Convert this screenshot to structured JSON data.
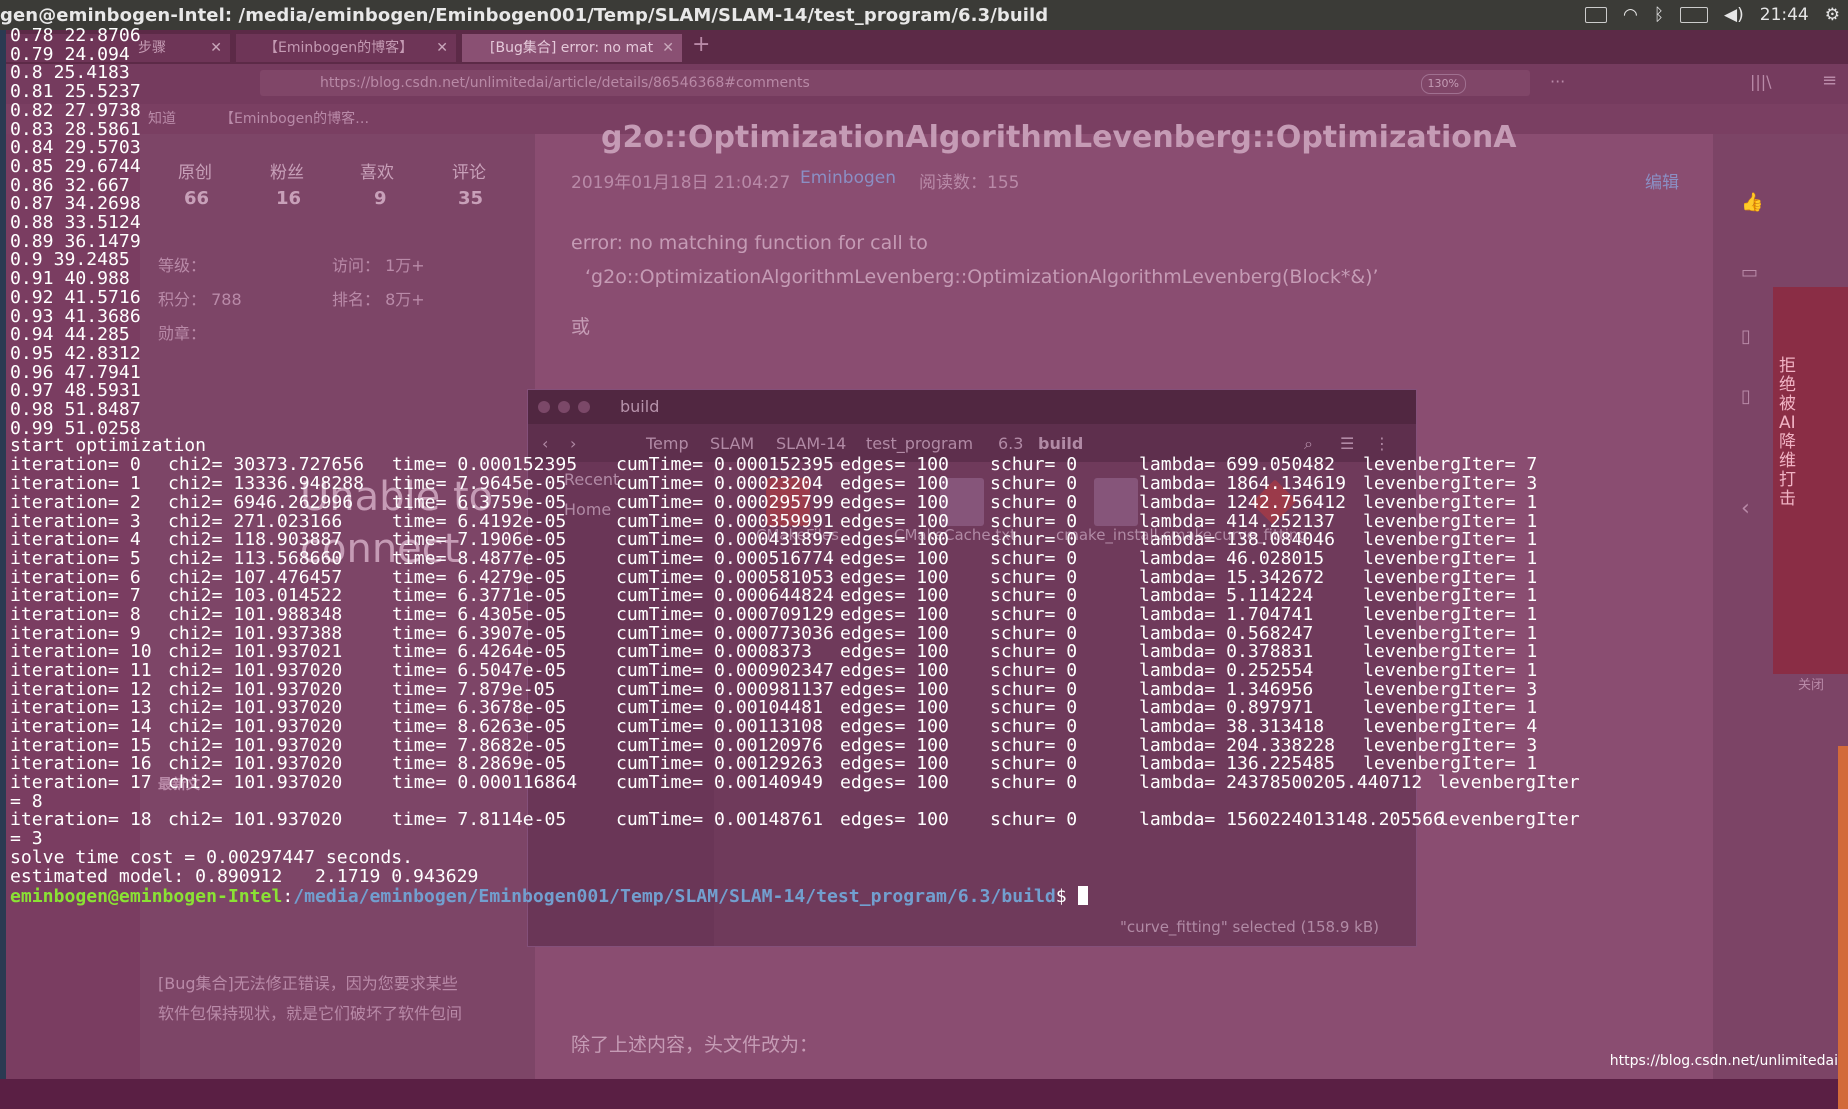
{
  "topbar": {
    "title": "gen@eminbogen-Intel: /media/eminbogen/Eminbogen001/Temp/SLAM/SLAM-14/test_program/6.3/build",
    "clock": "21:44"
  },
  "browser": {
    "tabs": [
      "步骤",
      "【Eminbogen的博客】",
      "[Bug集合] error: no mat"
    ],
    "url": "https://blog.csdn.net/unlimitedai/article/details/86546368#comments",
    "zoom": "130%",
    "bookmark_1": "知道",
    "bookmark_2": "【Eminbogen的博客…",
    "article_title": "g2o::OptimizationAlgorithmLevenberg::OptimizationA",
    "article_date": "2019年01月18日 21:04:27",
    "article_author": "Eminbogen",
    "article_reads": "阅读数：155",
    "edit_link": "编辑",
    "body_line_1": "error: no matching function for call to",
    "body_line_2": "‘g2o::OptimizationAlgorithmLevenberg::OptimizationAlgorithmLevenberg(Block*&)’",
    "body_line_3": "或",
    "body_line_4": "除了上述内容，头文件改为：",
    "stats": [
      {
        "label": "原创",
        "value": "66"
      },
      {
        "label": "粉丝",
        "value": "16"
      },
      {
        "label": "喜欢",
        "value": "9"
      },
      {
        "label": "评论",
        "value": "35"
      }
    ],
    "level_label": "等级：",
    "visits": "访问：  1万+",
    "points": "积分：  788",
    "rank": "排名：  8万+",
    "medal": "勋章：",
    "unable_1": "Unable to",
    "unable_2": "connect",
    "latest": "最新文",
    "side_link_1": "[Bug集合]无法修正错误，因为您要求某些",
    "side_link_2": "软件包保持现状，就是它们破坏了软件包间",
    "rail_close": "关闭",
    "rail_promo": "拒绝被AI降维打击"
  },
  "filemgr": {
    "title": "build",
    "crumbs": [
      "Temp",
      "SLAM",
      "SLAM-14",
      "test_program",
      "6.3",
      "build"
    ],
    "side_items": [
      "Recent",
      "Home"
    ],
    "files": [
      "CMakeFiles",
      "CMakeCache.txt",
      "cmake_install.cmake",
      "curve_fitting"
    ],
    "status": "\"curve_fitting\" selected (158.9 kB)"
  },
  "terminal": {
    "data_lines": [
      "0.78 22.8706",
      "0.79 24.094",
      "0.8 25.4183",
      "0.81 25.5237",
      "0.82 27.9738",
      "0.83 28.5861",
      "0.84 29.5703",
      "0.85 29.6744",
      "0.86 32.667",
      "0.87 34.2698",
      "0.88 33.5124",
      "0.89 36.1479",
      "0.9 39.2485",
      "0.91 40.988",
      "0.92 41.5716",
      "0.93 41.3686",
      "0.94 44.285",
      "0.95 42.8312",
      "0.96 47.7941",
      "0.97 48.5931",
      "0.98 51.8487",
      "0.99 51.0258"
    ],
    "start": "start optimization",
    "iterations": [
      {
        "it": "iteration= 0",
        "chi": "chi2= 30373.727656",
        "time": "time= 0.000152395",
        "cum": "cumTime= 0.000152395",
        "edges": "edges= 100",
        "schur": "schur= 0",
        "lambda": "lambda= 699.050482",
        "lev": "levenbergIter= 7"
      },
      {
        "it": "iteration= 1",
        "chi": "chi2= 13336.948288",
        "time": "time= 7.9645e-05",
        "cum": "cumTime= 0.00023204",
        "edges": "edges= 100",
        "schur": "schur= 0",
        "lambda": "lambda= 1864.134619",
        "lev": "levenbergIter= 3"
      },
      {
        "it": "iteration= 2",
        "chi": "chi2= 6946.262996",
        "time": "time= 6.3759e-05",
        "cum": "cumTime= 0.000295799",
        "edges": "edges= 100",
        "schur": "schur= 0",
        "lambda": "lambda= 1242.756412",
        "lev": "levenbergIter= 1"
      },
      {
        "it": "iteration= 3",
        "chi": "chi2= 271.023166",
        "time": "time= 6.4192e-05",
        "cum": "cumTime= 0.000359991",
        "edges": "edges= 100",
        "schur": "schur= 0",
        "lambda": "lambda= 414.252137",
        "lev": "levenbergIter= 1"
      },
      {
        "it": "iteration= 4",
        "chi": "chi2= 118.903887",
        "time": "time= 7.1906e-05",
        "cum": "cumTime= 0.000431897",
        "edges": "edges= 100",
        "schur": "schur= 0",
        "lambda": "lambda= 138.084046",
        "lev": "levenbergIter= 1"
      },
      {
        "it": "iteration= 5",
        "chi": "chi2= 113.568660",
        "time": "time= 8.4877e-05",
        "cum": "cumTime= 0.000516774",
        "edges": "edges= 100",
        "schur": "schur= 0",
        "lambda": "lambda= 46.028015",
        "lev": "levenbergIter= 1"
      },
      {
        "it": "iteration= 6",
        "chi": "chi2= 107.476457",
        "time": "time= 6.4279e-05",
        "cum": "cumTime= 0.000581053",
        "edges": "edges= 100",
        "schur": "schur= 0",
        "lambda": "lambda= 15.342672",
        "lev": "levenbergIter= 1"
      },
      {
        "it": "iteration= 7",
        "chi": "chi2= 103.014522",
        "time": "time= 6.3771e-05",
        "cum": "cumTime= 0.000644824",
        "edges": "edges= 100",
        "schur": "schur= 0",
        "lambda": "lambda= 5.114224",
        "lev": "levenbergIter= 1"
      },
      {
        "it": "iteration= 8",
        "chi": "chi2= 101.988348",
        "time": "time= 6.4305e-05",
        "cum": "cumTime= 0.000709129",
        "edges": "edges= 100",
        "schur": "schur= 0",
        "lambda": "lambda= 1.704741",
        "lev": "levenbergIter= 1"
      },
      {
        "it": "iteration= 9",
        "chi": "chi2= 101.937388",
        "time": "time= 6.3907e-05",
        "cum": "cumTime= 0.000773036",
        "edges": "edges= 100",
        "schur": "schur= 0",
        "lambda": "lambda= 0.568247",
        "lev": "levenbergIter= 1"
      },
      {
        "it": "iteration= 10",
        "chi": "chi2= 101.937021",
        "time": "time= 6.4264e-05",
        "cum": "cumTime= 0.0008373",
        "edges": "edges= 100",
        "schur": "schur= 0",
        "lambda": "lambda= 0.378831",
        "lev": "levenbergIter= 1"
      },
      {
        "it": "iteration= 11",
        "chi": "chi2= 101.937020",
        "time": "time= 6.5047e-05",
        "cum": "cumTime= 0.000902347",
        "edges": "edges= 100",
        "schur": "schur= 0",
        "lambda": "lambda= 0.252554",
        "lev": "levenbergIter= 1"
      },
      {
        "it": "iteration= 12",
        "chi": "chi2= 101.937020",
        "time": "time= 7.879e-05",
        "cum": "cumTime= 0.000981137",
        "edges": "edges= 100",
        "schur": "schur= 0",
        "lambda": "lambda= 1.346956",
        "lev": "levenbergIter= 3"
      },
      {
        "it": "iteration= 13",
        "chi": "chi2= 101.937020",
        "time": "time= 6.3678e-05",
        "cum": "cumTime= 0.00104481",
        "edges": "edges= 100",
        "schur": "schur= 0",
        "lambda": "lambda= 0.897971",
        "lev": "levenbergIter= 1"
      },
      {
        "it": "iteration= 14",
        "chi": "chi2= 101.937020",
        "time": "time= 8.6263e-05",
        "cum": "cumTime= 0.00113108",
        "edges": "edges= 100",
        "schur": "schur= 0",
        "lambda": "lambda= 38.313418",
        "lev": "levenbergIter= 4"
      },
      {
        "it": "iteration= 15",
        "chi": "chi2= 101.937020",
        "time": "time= 7.8682e-05",
        "cum": "cumTime= 0.00120976",
        "edges": "edges= 100",
        "schur": "schur= 0",
        "lambda": "lambda= 204.338228",
        "lev": "levenbergIter= 3"
      },
      {
        "it": "iteration= 16",
        "chi": "chi2= 101.937020",
        "time": "time= 8.2869e-05",
        "cum": "cumTime= 0.00129263",
        "edges": "edges= 100",
        "schur": "schur= 0",
        "lambda": "lambda= 136.225485",
        "lev": "levenbergIter= 1"
      },
      {
        "it": "iteration= 17",
        "chi": "chi2= 101.937020",
        "time": "time= 0.000116864",
        "cum": "cumTime= 0.00140949",
        "edges": "edges= 100",
        "schur": "schur= 0",
        "lambda": "lambda= 24378500205.440712",
        "lev": "levenbergIter"
      },
      {
        "it": "iteration= 18",
        "chi": "chi2= 101.937020",
        "time": "time= 7.8114e-05",
        "cum": "cumTime= 0.00148761",
        "edges": "edges= 100",
        "schur": "schur= 0",
        "lambda": "lambda= 1560224013148.205566",
        "lev": "levenbergIter"
      }
    ],
    "wrap_17": "= 8",
    "wrap_18": "= 3",
    "solve_time": "solve time cost = 0.00297447 seconds.",
    "estimated": "estimated model: 0.890912   2.1719 0.943629",
    "prompt_user": "eminbogen@eminbogen-Intel",
    "prompt_sep": ":",
    "prompt_path": "/media/eminbogen/Eminbogen001/Temp/SLAM/SLAM-14/test_program/6.3/build",
    "prompt_end": "$ "
  },
  "watermark": "https://blog.csdn.net/unlimitedai",
  "colors": {
    "terminal_bg": "#5a1f44",
    "prompt_user": "#8ae234",
    "prompt_path": "#729fcf",
    "text": "#ffffff"
  }
}
